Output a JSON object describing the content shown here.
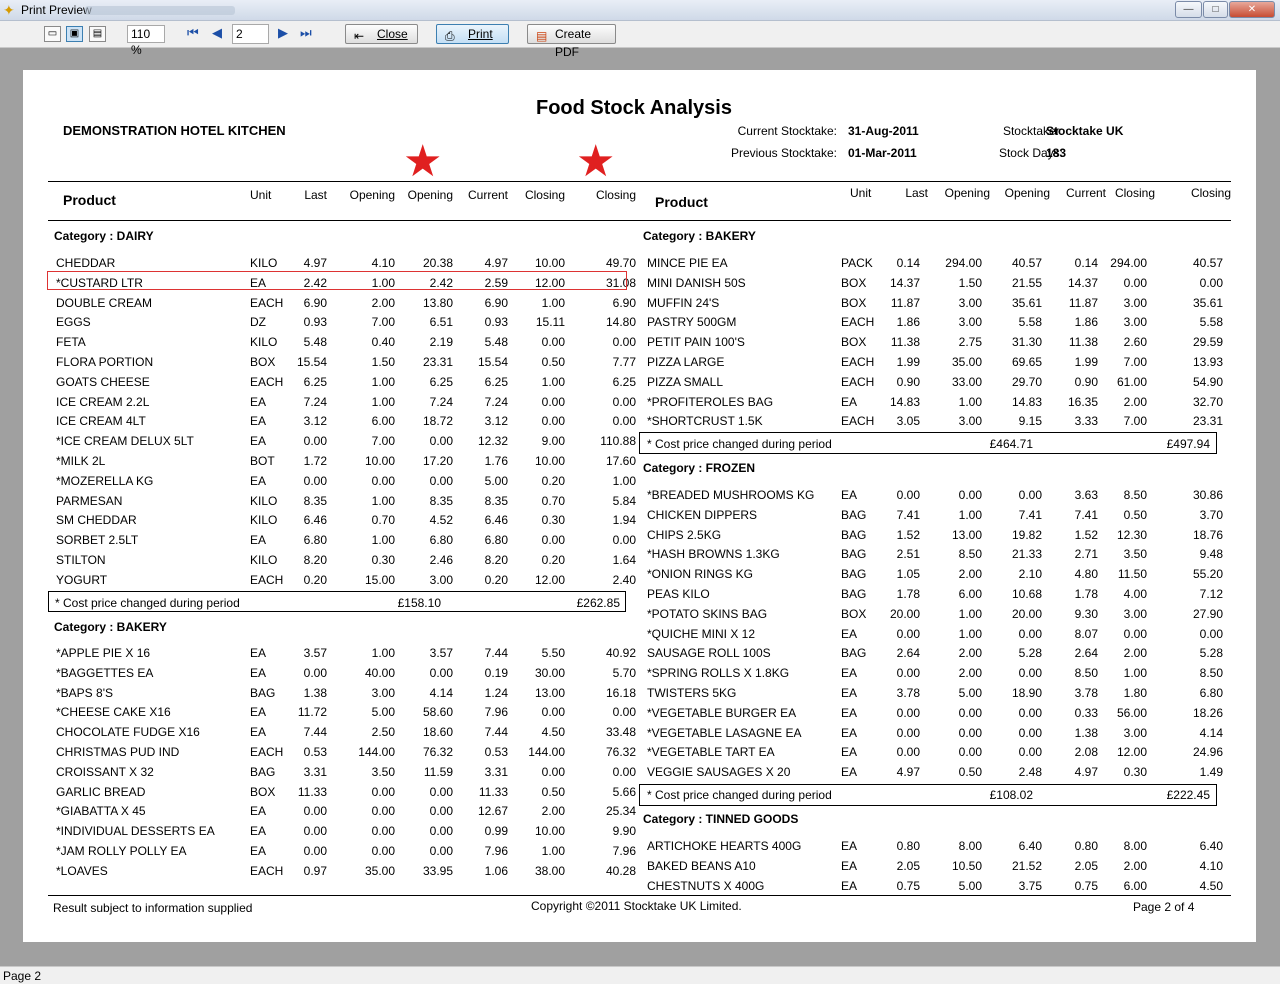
{
  "window": {
    "title": "Print Preview",
    "min_label": "—",
    "max_label": "□",
    "close_label": "✕"
  },
  "toolbar": {
    "zoom": "110 %",
    "page_input": "2",
    "close_label": "Close",
    "print_label": "Print",
    "pdf_label": "Create PDF"
  },
  "status": {
    "page": "Page 2"
  },
  "report": {
    "title": "Food Stock Analysis",
    "kitchen": "DEMONSTRATION HOTEL KITCHEN",
    "current_label": "Current Stocktake:",
    "current_value": "31-Aug-2011",
    "previous_label": "Previous Stocktake:",
    "previous_value": "01-Mar-2011",
    "stocktaker_label": "Stocktaker:",
    "stocktaker_value": "Stocktake UK",
    "days_label": "Stock Days:",
    "days_value": "183",
    "footer_left": "Result subject to information supplied",
    "footer_center": "Copyright ©2011 Stocktake UK Limited.",
    "footer_right": "Page 2 of 4",
    "cost_note": "* Cost price changed during period"
  },
  "columns": {
    "product": "Product",
    "unit": "Unit",
    "last": "Last",
    "opening1": "Opening",
    "opening2": "Opening",
    "current": "Current",
    "closing1": "Closing",
    "closing2": "Closing"
  },
  "left": {
    "dairy": {
      "category": "Category : DAIRY",
      "rows": [
        [
          "CHEDDAR",
          "KILO",
          "4.97",
          "4.10",
          "20.38",
          "4.97",
          "10.00",
          "49.70"
        ],
        [
          "*CUSTARD  LTR",
          "EA",
          "2.42",
          "1.00",
          "2.42",
          "2.59",
          "12.00",
          "31.08"
        ],
        [
          "DOUBLE CREAM",
          "EACH",
          "6.90",
          "2.00",
          "13.80",
          "6.90",
          "1.00",
          "6.90"
        ],
        [
          "EGGS",
          "DZ",
          "0.93",
          "7.00",
          "6.51",
          "0.93",
          "15.11",
          "14.80"
        ],
        [
          "FETA",
          "KILO",
          "5.48",
          "0.40",
          "2.19",
          "5.48",
          "0.00",
          "0.00"
        ],
        [
          "FLORA PORTION",
          "BOX",
          "15.54",
          "1.50",
          "23.31",
          "15.54",
          "0.50",
          "7.77"
        ],
        [
          "GOATS CHEESE",
          "EACH",
          "6.25",
          "1.00",
          "6.25",
          "6.25",
          "1.00",
          "6.25"
        ],
        [
          "ICE CREAM 2.2L",
          "EA",
          "7.24",
          "1.00",
          "7.24",
          "7.24",
          "0.00",
          "0.00"
        ],
        [
          "ICE CREAM 4LT",
          "EA",
          "3.12",
          "6.00",
          "18.72",
          "3.12",
          "0.00",
          "0.00"
        ],
        [
          "*ICE CREAM DELUX 5LT",
          "EA",
          "0.00",
          "7.00",
          "0.00",
          "12.32",
          "9.00",
          "110.88"
        ],
        [
          "*MILK 2L",
          "BOT",
          "1.72",
          "10.00",
          "17.20",
          "1.76",
          "10.00",
          "17.60"
        ],
        [
          "*MOZERELLA  KG",
          "EA",
          "0.00",
          "0.00",
          "0.00",
          "5.00",
          "0.20",
          "1.00"
        ],
        [
          "PARMESAN",
          "KILO",
          "8.35",
          "1.00",
          "8.35",
          "8.35",
          "0.70",
          "5.84"
        ],
        [
          "SM CHEDDAR",
          "KILO",
          "6.46",
          "0.70",
          "4.52",
          "6.46",
          "0.30",
          "1.94"
        ],
        [
          "SORBET 2.5LT",
          "EA",
          "6.80",
          "1.00",
          "6.80",
          "6.80",
          "0.00",
          "0.00"
        ],
        [
          "STILTON",
          "KILO",
          "8.20",
          "0.30",
          "2.46",
          "8.20",
          "0.20",
          "1.64"
        ],
        [
          "YOGURT",
          "EACH",
          "0.20",
          "15.00",
          "3.00",
          "0.20",
          "12.00",
          "2.40"
        ]
      ],
      "total_opening": "£158.10",
      "total_closing": "£262.85"
    },
    "bakery": {
      "category": "Category : BAKERY",
      "rows": [
        [
          "*APPLE PIE  X 16",
          "EA",
          "3.57",
          "1.00",
          "3.57",
          "7.44",
          "5.50",
          "40.92"
        ],
        [
          "*BAGGETTES  EA",
          "EA",
          "0.00",
          "40.00",
          "0.00",
          "0.19",
          "30.00",
          "5.70"
        ],
        [
          "*BAPS 8'S",
          "BAG",
          "1.38",
          "3.00",
          "4.14",
          "1.24",
          "13.00",
          "16.18"
        ],
        [
          "*CHEESE CAKE  X16",
          "EA",
          "11.72",
          "5.00",
          "58.60",
          "7.96",
          "0.00",
          "0.00"
        ],
        [
          "CHOCOLATE FUDGE  X16",
          "EA",
          "7.44",
          "2.50",
          "18.60",
          "7.44",
          "4.50",
          "33.48"
        ],
        [
          "CHRISTMAS PUD IND",
          "EACH",
          "0.53",
          "144.00",
          "76.32",
          "0.53",
          "144.00",
          "76.32"
        ],
        [
          "CROISSANT  X 32",
          "BAG",
          "3.31",
          "3.50",
          "11.59",
          "3.31",
          "0.00",
          "0.00"
        ],
        [
          "GARLIC BREAD",
          "BOX",
          "11.33",
          "0.00",
          "0.00",
          "11.33",
          "0.50",
          "5.66"
        ],
        [
          "*GIABATTA  X  45",
          "EA",
          "0.00",
          "0.00",
          "0.00",
          "12.67",
          "2.00",
          "25.34"
        ],
        [
          "*INDIVIDUAL DESSERTS  EA",
          "EA",
          "0.00",
          "0.00",
          "0.00",
          "0.99",
          "10.00",
          "9.90"
        ],
        [
          "*JAM ROLLY POLLY  EA",
          "EA",
          "0.00",
          "0.00",
          "0.00",
          "7.96",
          "1.00",
          "7.96"
        ],
        [
          "*LOAVES",
          "EACH",
          "0.97",
          "35.00",
          "33.95",
          "1.06",
          "38.00",
          "40.28"
        ]
      ]
    }
  },
  "right": {
    "bakery": {
      "category": "Category : BAKERY",
      "rows": [
        [
          "MINCE PIE   EA",
          "PACK",
          "0.14",
          "294.00",
          "40.57",
          "0.14",
          "294.00",
          "40.57"
        ],
        [
          "MINI DANISH 50S",
          "BOX",
          "14.37",
          "1.50",
          "21.55",
          "14.37",
          "0.00",
          "0.00"
        ],
        [
          "MUFFIN 24'S",
          "BOX",
          "11.87",
          "3.00",
          "35.61",
          "11.87",
          "3.00",
          "35.61"
        ],
        [
          "PASTRY 500GM",
          "EACH",
          "1.86",
          "3.00",
          "5.58",
          "1.86",
          "3.00",
          "5.58"
        ],
        [
          "PETIT PAIN 100'S",
          "BOX",
          "11.38",
          "2.75",
          "31.30",
          "11.38",
          "2.60",
          "29.59"
        ],
        [
          "PIZZA LARGE",
          "EACH",
          "1.99",
          "35.00",
          "69.65",
          "1.99",
          "7.00",
          "13.93"
        ],
        [
          "PIZZA SMALL",
          "EACH",
          "0.90",
          "33.00",
          "29.70",
          "0.90",
          "61.00",
          "54.90"
        ],
        [
          "*PROFITEROLES  BAG",
          "EA",
          "14.83",
          "1.00",
          "14.83",
          "16.35",
          "2.00",
          "32.70"
        ],
        [
          "*SHORTCRUST 1.5K",
          "EACH",
          "3.05",
          "3.00",
          "9.15",
          "3.33",
          "7.00",
          "23.31"
        ]
      ],
      "total_opening": "£464.71",
      "total_closing": "£497.94"
    },
    "frozen": {
      "category": "Category : FROZEN",
      "rows": [
        [
          "*BREADED MUSHROOMS  KG",
          "EA",
          "0.00",
          "0.00",
          "0.00",
          "3.63",
          "8.50",
          "30.86"
        ],
        [
          "CHICKEN DIPPERS",
          "BAG",
          "7.41",
          "1.00",
          "7.41",
          "7.41",
          "0.50",
          "3.70"
        ],
        [
          "CHIPS  2.5KG",
          "BAG",
          "1.52",
          "13.00",
          "19.82",
          "1.52",
          "12.30",
          "18.76"
        ],
        [
          "*HASH BROWNS  1.3KG",
          "BAG",
          "2.51",
          "8.50",
          "21.33",
          "2.71",
          "3.50",
          "9.48"
        ],
        [
          "*ONION RINGS  KG",
          "BAG",
          "1.05",
          "2.00",
          "2.10",
          "4.80",
          "11.50",
          "55.20"
        ],
        [
          "PEAS KILO",
          "BAG",
          "1.78",
          "6.00",
          "10.68",
          "1.78",
          "4.00",
          "7.12"
        ],
        [
          "*POTATO SKINS  BAG",
          "BOX",
          "20.00",
          "1.00",
          "20.00",
          "9.30",
          "3.00",
          "27.90"
        ],
        [
          "*QUICHE MINI X 12",
          "EA",
          "0.00",
          "1.00",
          "0.00",
          "8.07",
          "0.00",
          "0.00"
        ],
        [
          "SAUSAGE ROLL 100S",
          "BAG",
          "2.64",
          "2.00",
          "5.28",
          "2.64",
          "2.00",
          "5.28"
        ],
        [
          "*SPRING ROLLS X 1.8KG",
          "EA",
          "0.00",
          "2.00",
          "0.00",
          "8.50",
          "1.00",
          "8.50"
        ],
        [
          "TWISTERS  5KG",
          "EA",
          "3.78",
          "5.00",
          "18.90",
          "3.78",
          "1.80",
          "6.80"
        ],
        [
          "*VEGETABLE BURGER EA",
          "EA",
          "0.00",
          "0.00",
          "0.00",
          "0.33",
          "56.00",
          "18.26"
        ],
        [
          "*VEGETABLE LASAGNE  EA",
          "EA",
          "0.00",
          "0.00",
          "0.00",
          "1.38",
          "3.00",
          "4.14"
        ],
        [
          "*VEGETABLE TART  EA",
          "EA",
          "0.00",
          "0.00",
          "0.00",
          "2.08",
          "12.00",
          "24.96"
        ],
        [
          "VEGGIE SAUSAGES X 20",
          "EA",
          "4.97",
          "0.50",
          "2.48",
          "4.97",
          "0.30",
          "1.49"
        ]
      ],
      "total_opening": "£108.02",
      "total_closing": "£222.45"
    },
    "tinned": {
      "category": "Category : TINNED GOODS",
      "rows": [
        [
          "ARTICHOKE HEARTS 400G",
          "EA",
          "0.80",
          "8.00",
          "6.40",
          "0.80",
          "8.00",
          "6.40"
        ],
        [
          "BAKED BEANS A10",
          "EA",
          "2.05",
          "10.50",
          "21.52",
          "2.05",
          "2.00",
          "4.10"
        ],
        [
          "CHESTNUTS X 400G",
          "EA",
          "0.75",
          "5.00",
          "3.75",
          "0.75",
          "6.00",
          "4.50"
        ]
      ]
    }
  }
}
